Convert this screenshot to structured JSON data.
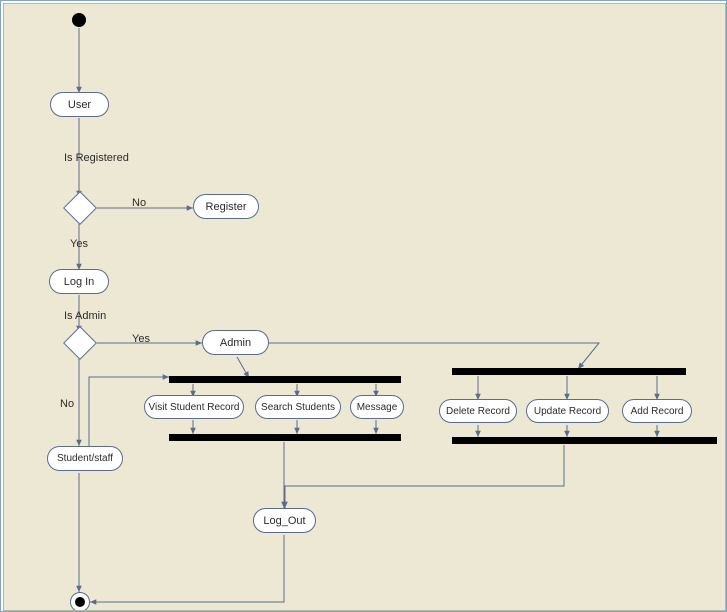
{
  "chart_data": {
    "type": "diagram",
    "diagram_kind": "uml-activity",
    "nodes": {
      "start": {
        "type": "initial"
      },
      "user": {
        "type": "activity",
        "label": "User"
      },
      "d_registered": {
        "type": "decision",
        "guard_label": "Is Registered"
      },
      "register": {
        "type": "activity",
        "label": "Register"
      },
      "login": {
        "type": "activity",
        "label": "Log In"
      },
      "d_admin": {
        "type": "decision",
        "guard_label": "Is Admin"
      },
      "admin": {
        "type": "activity",
        "label": "Admin"
      },
      "fork_left": {
        "type": "fork"
      },
      "visit": {
        "type": "activity",
        "label": "Visit  Student Record"
      },
      "search": {
        "type": "activity",
        "label": "Search Students"
      },
      "message": {
        "type": "activity",
        "label": "Message"
      },
      "join_left": {
        "type": "join"
      },
      "fork_right": {
        "type": "fork"
      },
      "delete": {
        "type": "activity",
        "label": "Delete Record"
      },
      "update": {
        "type": "activity",
        "label": "Update Record"
      },
      "add": {
        "type": "activity",
        "label": "Add Record"
      },
      "join_right": {
        "type": "join"
      },
      "student": {
        "type": "activity",
        "label": "Student/staff"
      },
      "logout": {
        "type": "activity",
        "label": "Log_Out"
      },
      "end": {
        "type": "final"
      }
    },
    "edges": [
      {
        "from": "start",
        "to": "user"
      },
      {
        "from": "user",
        "to": "d_registered"
      },
      {
        "from": "d_registered",
        "to": "register",
        "label": "No"
      },
      {
        "from": "d_registered",
        "to": "login",
        "label": "Yes"
      },
      {
        "from": "login",
        "to": "d_admin"
      },
      {
        "from": "d_admin",
        "to": "admin",
        "label": "Yes"
      },
      {
        "from": "d_admin",
        "to": "student",
        "label": "No"
      },
      {
        "from": "admin",
        "to": "fork_left"
      },
      {
        "from": "admin",
        "to": "fork_right"
      },
      {
        "from": "fork_left",
        "to": "visit"
      },
      {
        "from": "fork_left",
        "to": "search"
      },
      {
        "from": "fork_left",
        "to": "message"
      },
      {
        "from": "visit",
        "to": "join_left"
      },
      {
        "from": "search",
        "to": "join_left"
      },
      {
        "from": "message",
        "to": "join_left"
      },
      {
        "from": "fork_right",
        "to": "delete"
      },
      {
        "from": "fork_right",
        "to": "update"
      },
      {
        "from": "fork_right",
        "to": "add"
      },
      {
        "from": "delete",
        "to": "join_right"
      },
      {
        "from": "update",
        "to": "join_right"
      },
      {
        "from": "add",
        "to": "join_right"
      },
      {
        "from": "student",
        "to": "fork_left"
      },
      {
        "from": "join_left",
        "to": "logout"
      },
      {
        "from": "join_right",
        "to": "logout"
      },
      {
        "from": "student",
        "to": "end"
      },
      {
        "from": "logout",
        "to": "end"
      }
    ],
    "edge_labels": {
      "is_registered": "Is Registered",
      "is_admin": "Is Admin",
      "yes": "Yes",
      "no": "No"
    }
  }
}
